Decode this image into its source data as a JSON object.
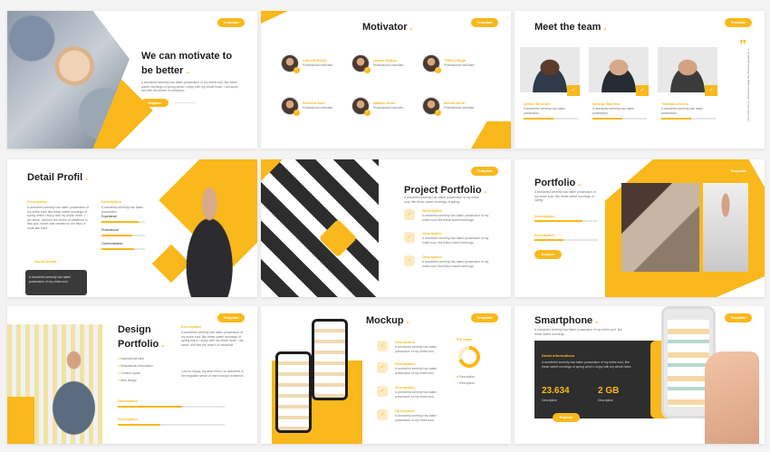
{
  "colors": {
    "accent": "#f9b81b",
    "dark": "#1e1e1e",
    "text": "#777777",
    "bg": "#ffffff"
  },
  "pill_label": "Template",
  "slide1": {
    "title_line1": "We can motivate to",
    "title_line2": "be better",
    "body": "A wonderful serenity has taken possession of my entire soul, like these sweet mornings of spring which I enjoy with my whole heart. I am alone, and feel the charm of existence.",
    "button": "Explore"
  },
  "slide2": {
    "title": "Motivator",
    "people": [
      {
        "name": "Vincent Hardy",
        "role": "Professional motivator"
      },
      {
        "name": "James Bolton",
        "role": "Professional motivator"
      },
      {
        "name": "Tiffany Rogo",
        "role": "Professional motivator"
      },
      {
        "name": "Roberta Alvo",
        "role": "Professional motivator"
      },
      {
        "name": "Nadine Anno",
        "role": "Professional motivator"
      },
      {
        "name": "Melvin Alvin",
        "role": "Professional motivator"
      }
    ]
  },
  "slide3": {
    "title": "Meet the team",
    "members": [
      {
        "name": "Arthur Brennon",
        "text": "A wonderful serenity has taken possession"
      },
      {
        "name": "George Baverse",
        "text": "A wonderful serenity has taken possession"
      },
      {
        "name": "Thomas Ahrens",
        "text": "A wonderful serenity has taken possession"
      }
    ],
    "side_text": "A wonderful serenity has taken possession of my entire soul"
  },
  "slide4": {
    "title": "Detail Profil",
    "desc_label": "Description",
    "desc_text": "A wonderful serenity has taken possession of my entire soul, like these sweet mornings of spring which I enjoy with my whole heart. I am alone, and feel the charm of existence in this spot, which was created for the bliss of souls like mine.",
    "desc2_label": "Description",
    "desc2_text": "A wonderful serenity has taken possession",
    "skills": [
      {
        "label": "Experience",
        "level": 0.85
      },
      {
        "label": "Professional",
        "level": 0.7
      },
      {
        "label": "Communication",
        "level": 0.75
      }
    ],
    "social_label": "Social media",
    "social_text": "A wonderful serenity has taken possession of my entire soul"
  },
  "slide5": {
    "title": "Project Portfolio",
    "intro": "A wonderful serenity has taken possession of my entire soul, like these sweet mornings of spring.",
    "items": [
      {
        "label": "Description",
        "text": "A wonderful serenity has taken possession of my entire soul, like these sweet mornings."
      },
      {
        "label": "Description",
        "text": "A wonderful serenity has taken possession of my entire soul, like these sweet mornings."
      },
      {
        "label": "Description",
        "text": "A wonderful serenity has taken possession of my entire soul, like these sweet mornings."
      }
    ]
  },
  "slide6": {
    "title": "Portfolio",
    "body": "A wonderful serenity has taken possession of my entire soul, like these sweet mornings of spring.",
    "d1": "Description",
    "d2": "Description",
    "level1": 0.75,
    "level2": 0.45,
    "button": "Explore"
  },
  "slide7": {
    "title_line1": "Design",
    "title_line2": "Portfolio",
    "desc_label": "Description",
    "desc_text": "A wonderful serenity has taken possession of my entire soul, like these sweet mornings of spring which I enjoy with my whole heart. I am alone, and feel the charm of existence.",
    "desc_text2": "I am so happy, my dear friend, so absorbed in the exquisite sense of mere tranquil existence.",
    "list": [
      "Inspirational idea",
      "Motivational information",
      "Creative quote",
      "New design"
    ],
    "bar1_label": "Description",
    "bar2_label": "Description",
    "level1": 0.6,
    "level2": 0.4
  },
  "slide8": {
    "title": "Mockup",
    "items": [
      {
        "label": "Description",
        "text": "A wonderful serenity has taken possession of my entire soul."
      },
      {
        "label": "Description",
        "text": "A wonderful serenity has taken possession of my entire soul."
      },
      {
        "label": "Description",
        "text": "A wonderful serenity has taken possession of my entire soul."
      },
      {
        "label": "Description",
        "text": "A wonderful serenity has taken possession of my entire soul."
      }
    ],
    "pie_title": "Pie chart",
    "legend": [
      "Description",
      "Description"
    ],
    "pie_fraction": 0.7
  },
  "slide9": {
    "title": "Smartphone",
    "body": "A wonderful serenity has taken possession of my entire soul, like these sweet mornings.",
    "detail_label": "Detail informations",
    "detail_text": "A wonderful serenity has taken possession of my entire soul, like these sweet mornings of spring which I enjoy with my whole heart.",
    "stat1": "23.634",
    "stat1_label": "Description",
    "stat2": "2 GB",
    "stat2_label": "Description",
    "button": "Explore"
  }
}
